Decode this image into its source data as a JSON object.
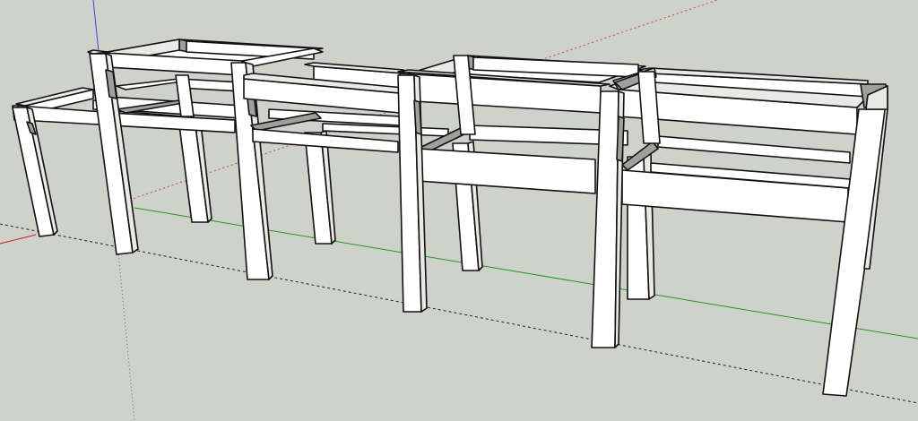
{
  "viewport": {
    "background_color": "#cfd1cb",
    "view": "perspective",
    "colors": {
      "face_front": "#ffffff",
      "face_side": "#e9eae6",
      "face_shadow": "#9ea09c",
      "edge": "#111111",
      "red_axis": "#cc2222",
      "green_axis": "#229922",
      "blue_axis": "#4444cc"
    }
  },
  "axes": [
    {
      "name": "red-axis",
      "style": "solid-and-dotted"
    },
    {
      "name": "green-axis",
      "style": "solid"
    },
    {
      "name": "blue-axis",
      "style": "solid-and-dotted"
    }
  ],
  "model": {
    "description_icon": "frame-bench-model",
    "components": [
      {
        "name": "left-low-frame"
      },
      {
        "name": "middle-high-frame"
      },
      {
        "name": "center-low-frame"
      },
      {
        "name": "right-high-frame"
      },
      {
        "name": "right-low-frame"
      }
    ]
  }
}
